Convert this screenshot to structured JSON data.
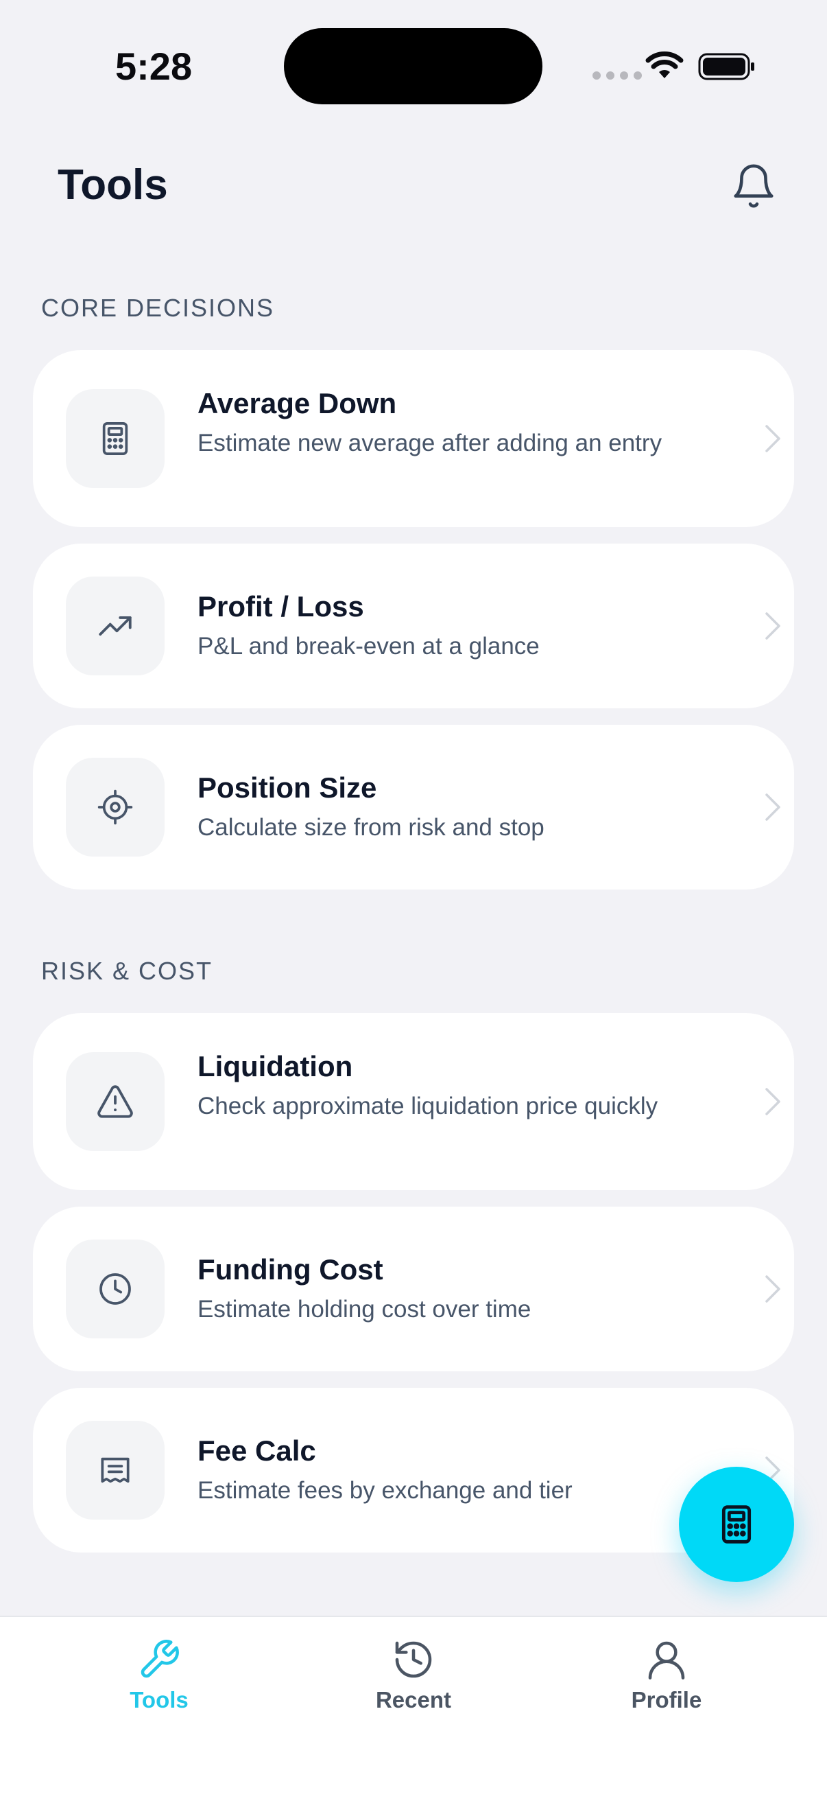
{
  "status_bar": {
    "time": "5:28"
  },
  "header": {
    "title": "Tools"
  },
  "sections": [
    {
      "label": "CORE DECISIONS",
      "items": [
        {
          "title": "Average Down",
          "description": "Estimate new average after adding an entry",
          "icon": "calculator-icon"
        },
        {
          "title": "Profit / Loss",
          "description": "P&L and break-even at a glance",
          "icon": "trending-up-icon"
        },
        {
          "title": "Position Size",
          "description": "Calculate size from risk and stop",
          "icon": "crosshair-icon"
        }
      ]
    },
    {
      "label": "RISK & COST",
      "items": [
        {
          "title": "Liquidation",
          "description": "Check approximate liquidation price quickly",
          "icon": "warning-icon"
        },
        {
          "title": "Funding Cost",
          "description": "Estimate holding cost over time",
          "icon": "clock-icon"
        },
        {
          "title": "Fee Calc",
          "description": "Estimate fees by exchange and tier",
          "icon": "receipt-icon"
        }
      ]
    }
  ],
  "tabbar": {
    "tabs": [
      {
        "label": "Tools",
        "icon": "wrench-icon",
        "active": true
      },
      {
        "label": "Recent",
        "icon": "history-icon",
        "active": false
      },
      {
        "label": "Profile",
        "icon": "user-icon",
        "active": false
      }
    ]
  },
  "colors": {
    "accent": "#00d9f7",
    "active_tab": "#22c7e8",
    "inactive_tab": "#4b5563",
    "background": "#f2f2f6"
  }
}
